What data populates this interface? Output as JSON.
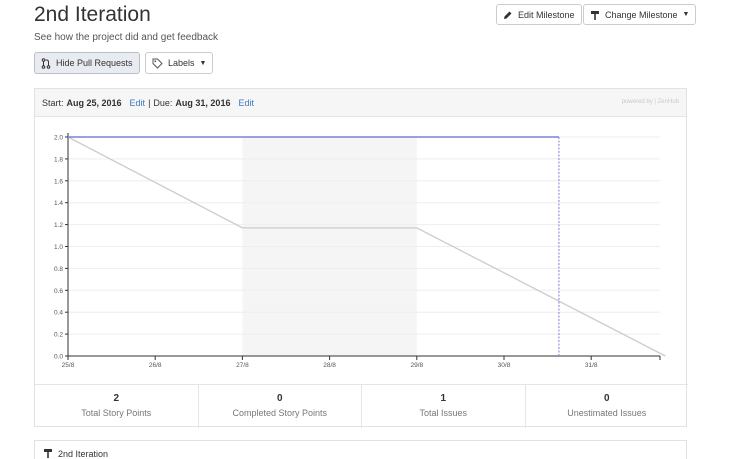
{
  "header": {
    "title": "2nd Iteration",
    "subtitle": "See how the project did and get feedback"
  },
  "toolbar": {
    "edit_milestone": "Edit Milestone",
    "change_milestone": "Change Milestone",
    "hide_pull_requests": "Hide Pull Requests",
    "labels": "Labels"
  },
  "milestone": {
    "start_label": "Start:",
    "start_date": "Aug 25, 2016",
    "edit_label": "Edit",
    "separator": "|",
    "due_label": "Due:",
    "due_date": "Aug 31, 2016",
    "powered_by": "powered by | ZenHub"
  },
  "chart_data": {
    "type": "line",
    "x_ticks": [
      "25/8",
      "26/8",
      "27/8",
      "28/8",
      "29/8",
      "30/8",
      "31/8"
    ],
    "y_ticks": [
      "0.0",
      "0.2",
      "0.4",
      "0.6",
      "0.8",
      "1.0",
      "1.2",
      "1.4",
      "1.6",
      "1.8",
      "2.0"
    ],
    "ylim": [
      0,
      2
    ],
    "weekend_shade": [
      "27/8",
      "29/8"
    ],
    "series": [
      {
        "color": "#cccccc",
        "points": [
          [
            0,
            2.0
          ],
          [
            2,
            1.17
          ],
          [
            4,
            1.17
          ],
          [
            6.85,
            0.0
          ]
        ]
      },
      {
        "color": "#7d80d6",
        "points": [
          [
            0,
            2.0
          ],
          [
            5.63,
            2.0
          ]
        ],
        "drop_at": 5.63
      }
    ],
    "grid": true
  },
  "stats": [
    {
      "value": "2",
      "label": "Total Story Points"
    },
    {
      "value": "0",
      "label": "Completed Story Points"
    },
    {
      "value": "1",
      "label": "Total Issues"
    },
    {
      "value": "0",
      "label": "Unestimated Issues"
    }
  ],
  "bottom": {
    "title": "2nd Iteration"
  },
  "colors": {
    "accent_link": "#3b78c2",
    "ideal_line": "#cccccc",
    "actual_line": "#7d80d6"
  }
}
